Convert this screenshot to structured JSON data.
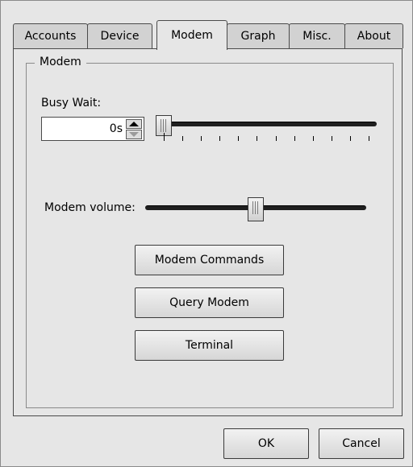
{
  "tabs": [
    {
      "label": "Accounts",
      "active": false
    },
    {
      "label": "Device",
      "active": false
    },
    {
      "label": "Modem",
      "active": true
    },
    {
      "label": "Graph",
      "active": false
    },
    {
      "label": "Misc.",
      "active": false
    },
    {
      "label": "About",
      "active": false
    }
  ],
  "modem_group": {
    "title": "Modem",
    "busy_wait": {
      "label": "Busy Wait:",
      "value": "0s",
      "slider_level": 0,
      "tick_count": 12
    },
    "modem_volume": {
      "label": "Modem volume:",
      "slider_level": 0.5
    },
    "buttons": {
      "modem_commands": "Modem Commands",
      "query_modem": "Query Modem",
      "terminal": "Terminal"
    }
  },
  "dialog_buttons": {
    "ok": "OK",
    "cancel": "Cancel"
  }
}
